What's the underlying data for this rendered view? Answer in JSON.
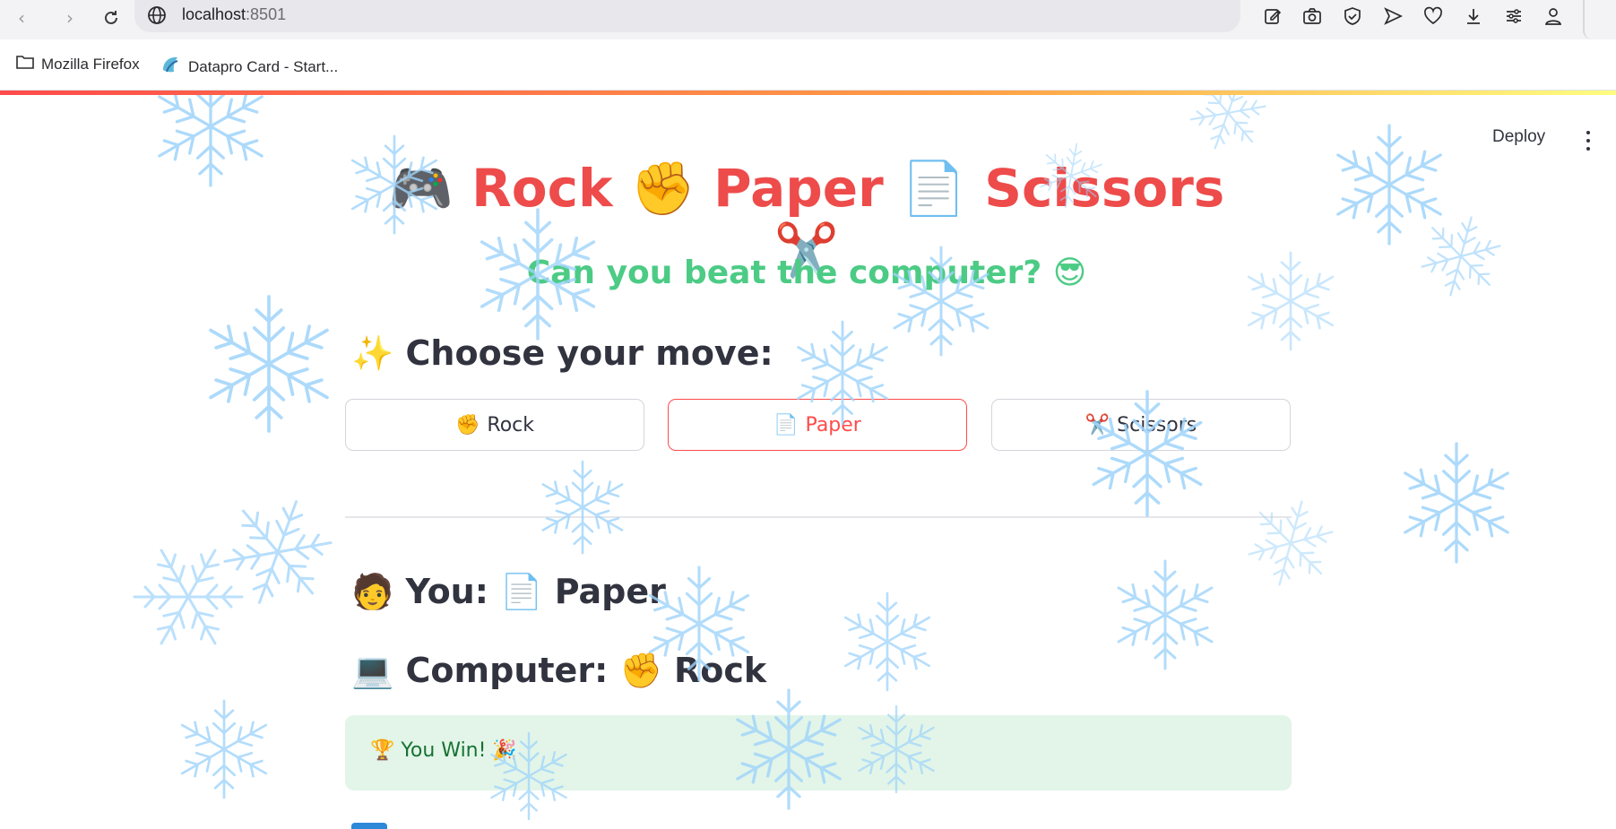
{
  "browser": {
    "url_host": "localhost",
    "url_port": ":8501",
    "bookmarks": [
      {
        "label": "Mozilla Firefox",
        "icon": "folder-icon"
      },
      {
        "label": "Datapro Card - Start...",
        "icon": "datapro-logo-icon"
      }
    ]
  },
  "app": {
    "deploy_label": "Deploy",
    "title": "🎮 Rock ✊ Paper 📄 Scissors ✂️",
    "subtitle": "Can you beat the computer? 😎",
    "choose_heading": "✨ Choose your move:",
    "moves": [
      {
        "icon": "✊",
        "label": "Rock"
      },
      {
        "icon": "📄",
        "label": "Paper"
      },
      {
        "icon": "✂️",
        "label": "Scissors"
      }
    ],
    "selected_move": "Paper",
    "you_line": "🧑 You: 📄 Paper",
    "computer_line": "💻 Computer: ✊ Rock",
    "result": "🏆 You Win! 🎉"
  },
  "colors": {
    "title": "#ee4b4b",
    "subtitle": "#4ccb85",
    "accent": "#ff4b4b",
    "success_bg": "#e2f5e8",
    "success_text": "#177233",
    "snowflake": "#9fd4fb"
  }
}
